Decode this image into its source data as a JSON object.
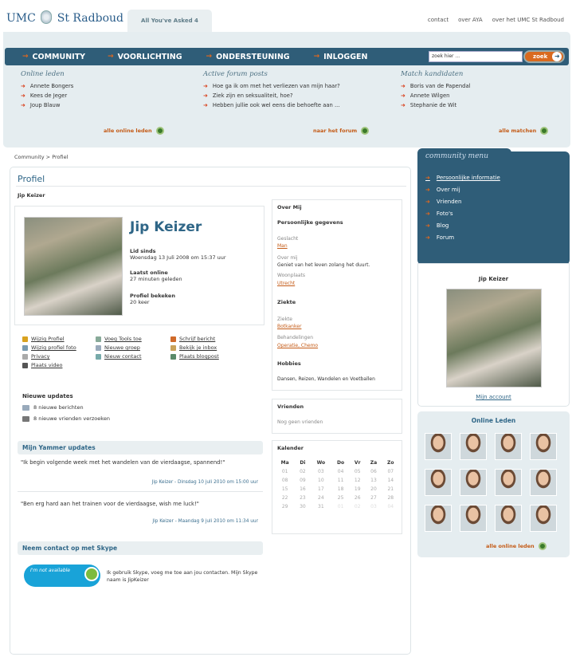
{
  "header": {
    "logo_text_left": "UMC",
    "logo_text_right": "St Radboud",
    "site_tab": "All You've Asked 4",
    "top_links": [
      "contact",
      "over AYA",
      "over het UMC St Radboud"
    ]
  },
  "nav": {
    "items": [
      "COMMUNITY",
      "VOORLICHTING",
      "ONDERSTEUNING",
      "INLOGGEN"
    ],
    "search_placeholder": "zoek hier ...",
    "search_button": "zoek"
  },
  "dropdown": {
    "online": {
      "title": "Online leden",
      "items": [
        "Annete Bongers",
        "Kees de Jeger",
        "Joup Blauw"
      ],
      "more": "alle online leden"
    },
    "forum": {
      "title": "Active forum posts",
      "items": [
        "Hoe ga ik om met het verliezen van mijn haar?",
        "Ziek zijn en seksualiteit, hoe?",
        "Hebben jullie ook wel eens die behoefte aan ..."
      ],
      "more": "naar het forum"
    },
    "match": {
      "title": "Match kandidaten",
      "items": [
        "Boris van de Papendal",
        "Annete Wilgen",
        "Stephanie de Wit"
      ],
      "more": "alle matchen"
    }
  },
  "breadcrumb": "Community > Profiel",
  "profile": {
    "page_title": "Profiel",
    "name_small": "Jip Keizer",
    "name": "Jip Keizer",
    "lid_sinds_label": "Lid sinds",
    "lid_sinds": "Woensdag 13 Juli 2008 om 15:37 uur",
    "laatst_online_label": "Laatst online",
    "laatst_online": "27 minuten geleden",
    "bekeken_label": "Profiel bekeken",
    "bekeken": "20 keer"
  },
  "actions": {
    "col1": [
      "Wijzig Profiel",
      "Wijzig profiel foto",
      "Privacy",
      "Plaats video"
    ],
    "col2": [
      "Voeg Tools toe",
      "Nieuwe groep",
      "Nieuw contact"
    ],
    "col3": [
      "Schrijf bericht",
      "Bekijk je inbox",
      "Plaats blogpost"
    ]
  },
  "updates": {
    "title": "Nieuwe updates",
    "items": [
      "8 nieuwe berichten",
      "8 nieuwe vrienden verzoeken"
    ]
  },
  "yammer": {
    "title": "Mijn Yammer updates",
    "posts": [
      {
        "text": "\"Ik begin volgende week met het wandelen van de vierdaagse, spannend!\"",
        "meta": "Jip Keizer - Dinsdag 10 juli 2010 om 15:00 uur"
      },
      {
        "text": "\"Ben erg hard aan het trainen voor de vierdaagse, wish me luck!\"",
        "meta": "Jip Keizer - Maandag 9 juli 2010 om 11:34 uur"
      }
    ]
  },
  "skype": {
    "title": "Neem contact op met Skype",
    "badge": "I'm not available",
    "text": "Ik gebruik Skype, voeg me toe aan jou contacten. Mijn Skype naam is JipKeizer"
  },
  "over_mij": {
    "title": "Over Mij",
    "persoonlijk": "Persoonlijke gegevens",
    "geslacht_label": "Geslacht",
    "geslacht": "Man",
    "over_label": "Over mij",
    "over": "Geniet van het leven zolang het duurt.",
    "woonplaats_label": "Woonplaats",
    "woonplaats": "Utrecht",
    "ziekte_head": "Ziekte",
    "ziekte_label": "Ziekte",
    "ziekte": "Botkanker",
    "behandelingen_label": "Behandelingen",
    "behandelingen": "Operatie, Chemo",
    "hobbies_head": "Hobbies",
    "hobbies": "Dansen, Reizen, Wandelen en Voetballen"
  },
  "vrienden": {
    "title": "Vrienden",
    "text": "Nog geen vrienden"
  },
  "kalender": {
    "title": "Kalender",
    "days": [
      "Ma",
      "Di",
      "Wo",
      "Do",
      "Vr",
      "Za",
      "Zo"
    ],
    "weeks": [
      [
        "01",
        "02",
        "03",
        "04",
        "05",
        "06",
        "07"
      ],
      [
        "08",
        "09",
        "10",
        "11",
        "12",
        "13",
        "14"
      ],
      [
        "15",
        "16",
        "17",
        "18",
        "19",
        "20",
        "21"
      ],
      [
        "22",
        "23",
        "24",
        "25",
        "26",
        "27",
        "28"
      ],
      [
        "29",
        "30",
        "31",
        "01",
        "02",
        "03",
        "04"
      ]
    ]
  },
  "community_menu": {
    "title": "community menu",
    "items": [
      "Persoonlijke informatie",
      "Over mij",
      "Vrienden",
      "Foto's",
      "Blog",
      "Forum"
    ],
    "card_name": "Jip Keizer",
    "account_link": "Mijn account"
  },
  "online_leden": {
    "title": "Online Leden",
    "more": "alle online leden"
  },
  "colors": {
    "primary": "#2f5d78",
    "accent": "#e0681e",
    "link_orange": "#c45b17",
    "panel": "#e5edf0"
  }
}
